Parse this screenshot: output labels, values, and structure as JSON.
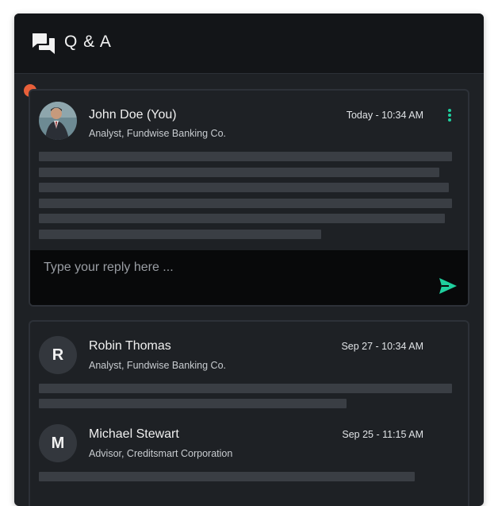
{
  "header": {
    "title": "Q & A",
    "icon": "chat-bubbles-icon"
  },
  "colors": {
    "accent": "#1fcf9e",
    "active_dot": "#e8603a",
    "panel_bg": "#1e2125",
    "header_bg": "#131518",
    "reply_bg": "#08090a"
  },
  "thread": {
    "question": {
      "author": "John Doe (You)",
      "role": "Analyst, Fundwise Banking Co.",
      "timestamp": "Today - 10:34 AM",
      "more_icon": "kebab-menu-icon"
    },
    "reply_box": {
      "placeholder": "Type your reply here ...",
      "send_icon": "send-icon"
    }
  },
  "answers": [
    {
      "author": "Robin Thomas",
      "initial": "R",
      "role": "Analyst, Fundwise Banking Co.",
      "timestamp": "Sep 27 - 10:34 AM"
    },
    {
      "author": "Michael Stewart",
      "initial": "M",
      "role": "Advisor, Creditsmart Corporation",
      "timestamp": "Sep 25 - 11:15 AM"
    }
  ]
}
